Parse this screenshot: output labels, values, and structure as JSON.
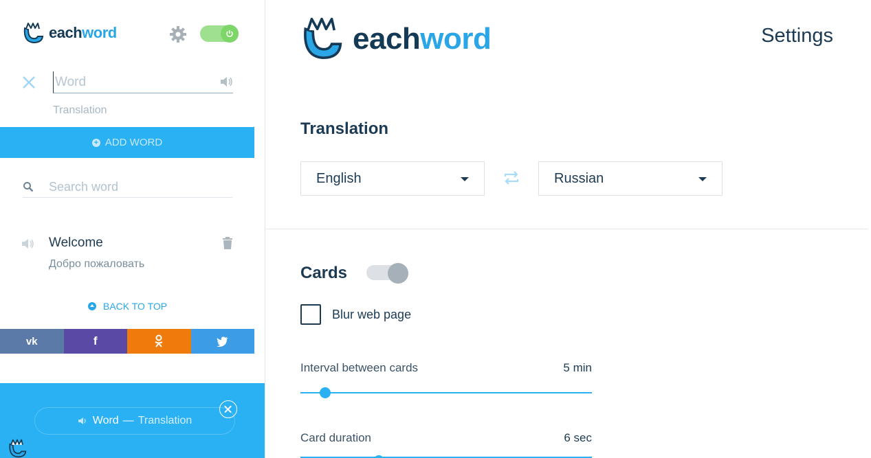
{
  "sidebar": {
    "logo": {
      "each": "each",
      "word": "word"
    },
    "word_input": {
      "value": "",
      "placeholder": "Word"
    },
    "translation_input": {
      "value": "",
      "placeholder": "Translation"
    },
    "add_word_label": "ADD WORD",
    "search": {
      "value": "",
      "placeholder": "Search word"
    },
    "words": [
      {
        "word": "Welcome",
        "translation": "Добро пожаловать"
      }
    ],
    "back_to_top_label": "BACK TO TOP",
    "social": [
      {
        "name": "vk",
        "glyph": "vk",
        "color": "#5b7aa8"
      },
      {
        "name": "facebook",
        "glyph": "f",
        "color": "#5a4aa5"
      },
      {
        "name": "odnoklassniki",
        "glyph": "ok",
        "color": "#ee7b0c"
      },
      {
        "name": "twitter",
        "glyph": "tw",
        "color": "#3c9ce6"
      }
    ],
    "preview": {
      "word": "Word",
      "dash": "—",
      "translation": "Translation"
    },
    "power_on": true
  },
  "main": {
    "logo": {
      "each": "each",
      "word": "word"
    },
    "title": "Settings",
    "translation_section": {
      "title": "Translation",
      "from_language": "English",
      "to_language": "Russian"
    },
    "cards_section": {
      "title": "Cards",
      "enabled": false,
      "blur_label": "Blur web page",
      "blur_checked": false,
      "interval": {
        "label": "Interval between cards",
        "value": "5 min",
        "fraction": 0.085
      },
      "duration": {
        "label": "Card duration",
        "value": "6 sec"
      }
    }
  },
  "colors": {
    "accent": "#2ab1f4",
    "brand_dark": "#143a56",
    "brand_light": "#2aa6e6",
    "power_on": "#7ed66b"
  }
}
